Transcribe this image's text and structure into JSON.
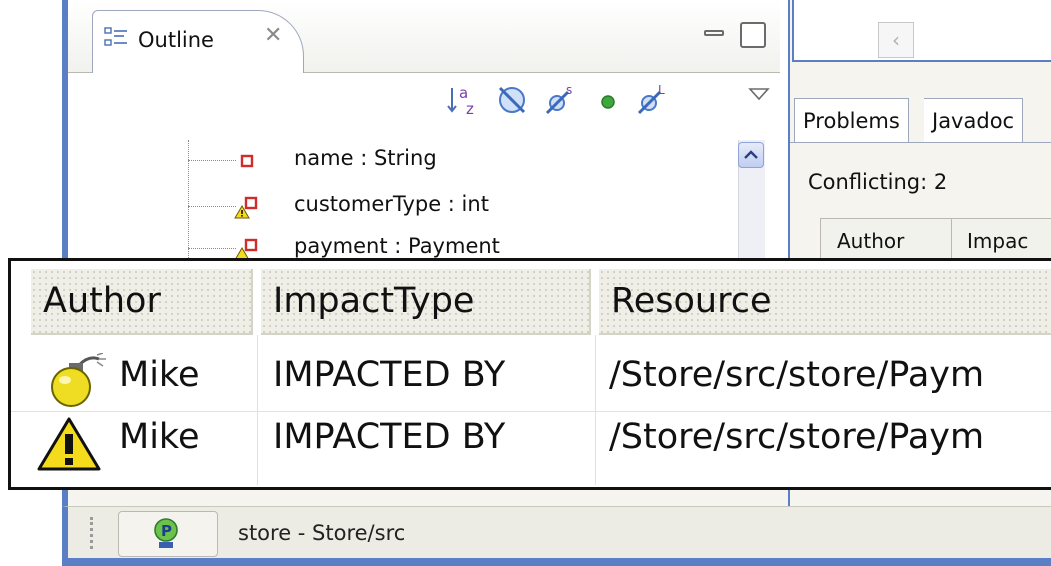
{
  "outline": {
    "tab_label": "Outline",
    "toolbar_icons": [
      "sort-alpha-icon",
      "hide-fields-icon",
      "hide-static-icon",
      "hide-nonpublic-icon",
      "hide-local-types-icon"
    ],
    "items": [
      {
        "label": "name : String",
        "icon": "private-field-icon"
      },
      {
        "label": "customerType : int",
        "icon": "private-field-warning-icon"
      },
      {
        "label": "payment : Payment",
        "icon": "private-field-warning-icon"
      }
    ]
  },
  "problems_view": {
    "tabs": [
      "Problems",
      "Javadoc"
    ],
    "conflict_text": "Conflicting: 2",
    "small_headers": [
      "Author",
      "Impac"
    ]
  },
  "zoom_table": {
    "columns": [
      "Author",
      "ImpactType",
      "Resource"
    ],
    "rows": [
      {
        "icon": "conflict-bomb-icon",
        "author": "Mike",
        "impact": "IMPACTED BY",
        "resource": "/Store/src/store/Paym"
      },
      {
        "icon": "warning-icon",
        "author": "Mike",
        "impact": "IMPACTED BY",
        "resource": "/Store/src/store/Paym"
      }
    ]
  },
  "status": {
    "text": "store - Store/src"
  },
  "colors": {
    "view_border": "#5b7fc4",
    "warning_yellow": "#f4dc1c"
  }
}
